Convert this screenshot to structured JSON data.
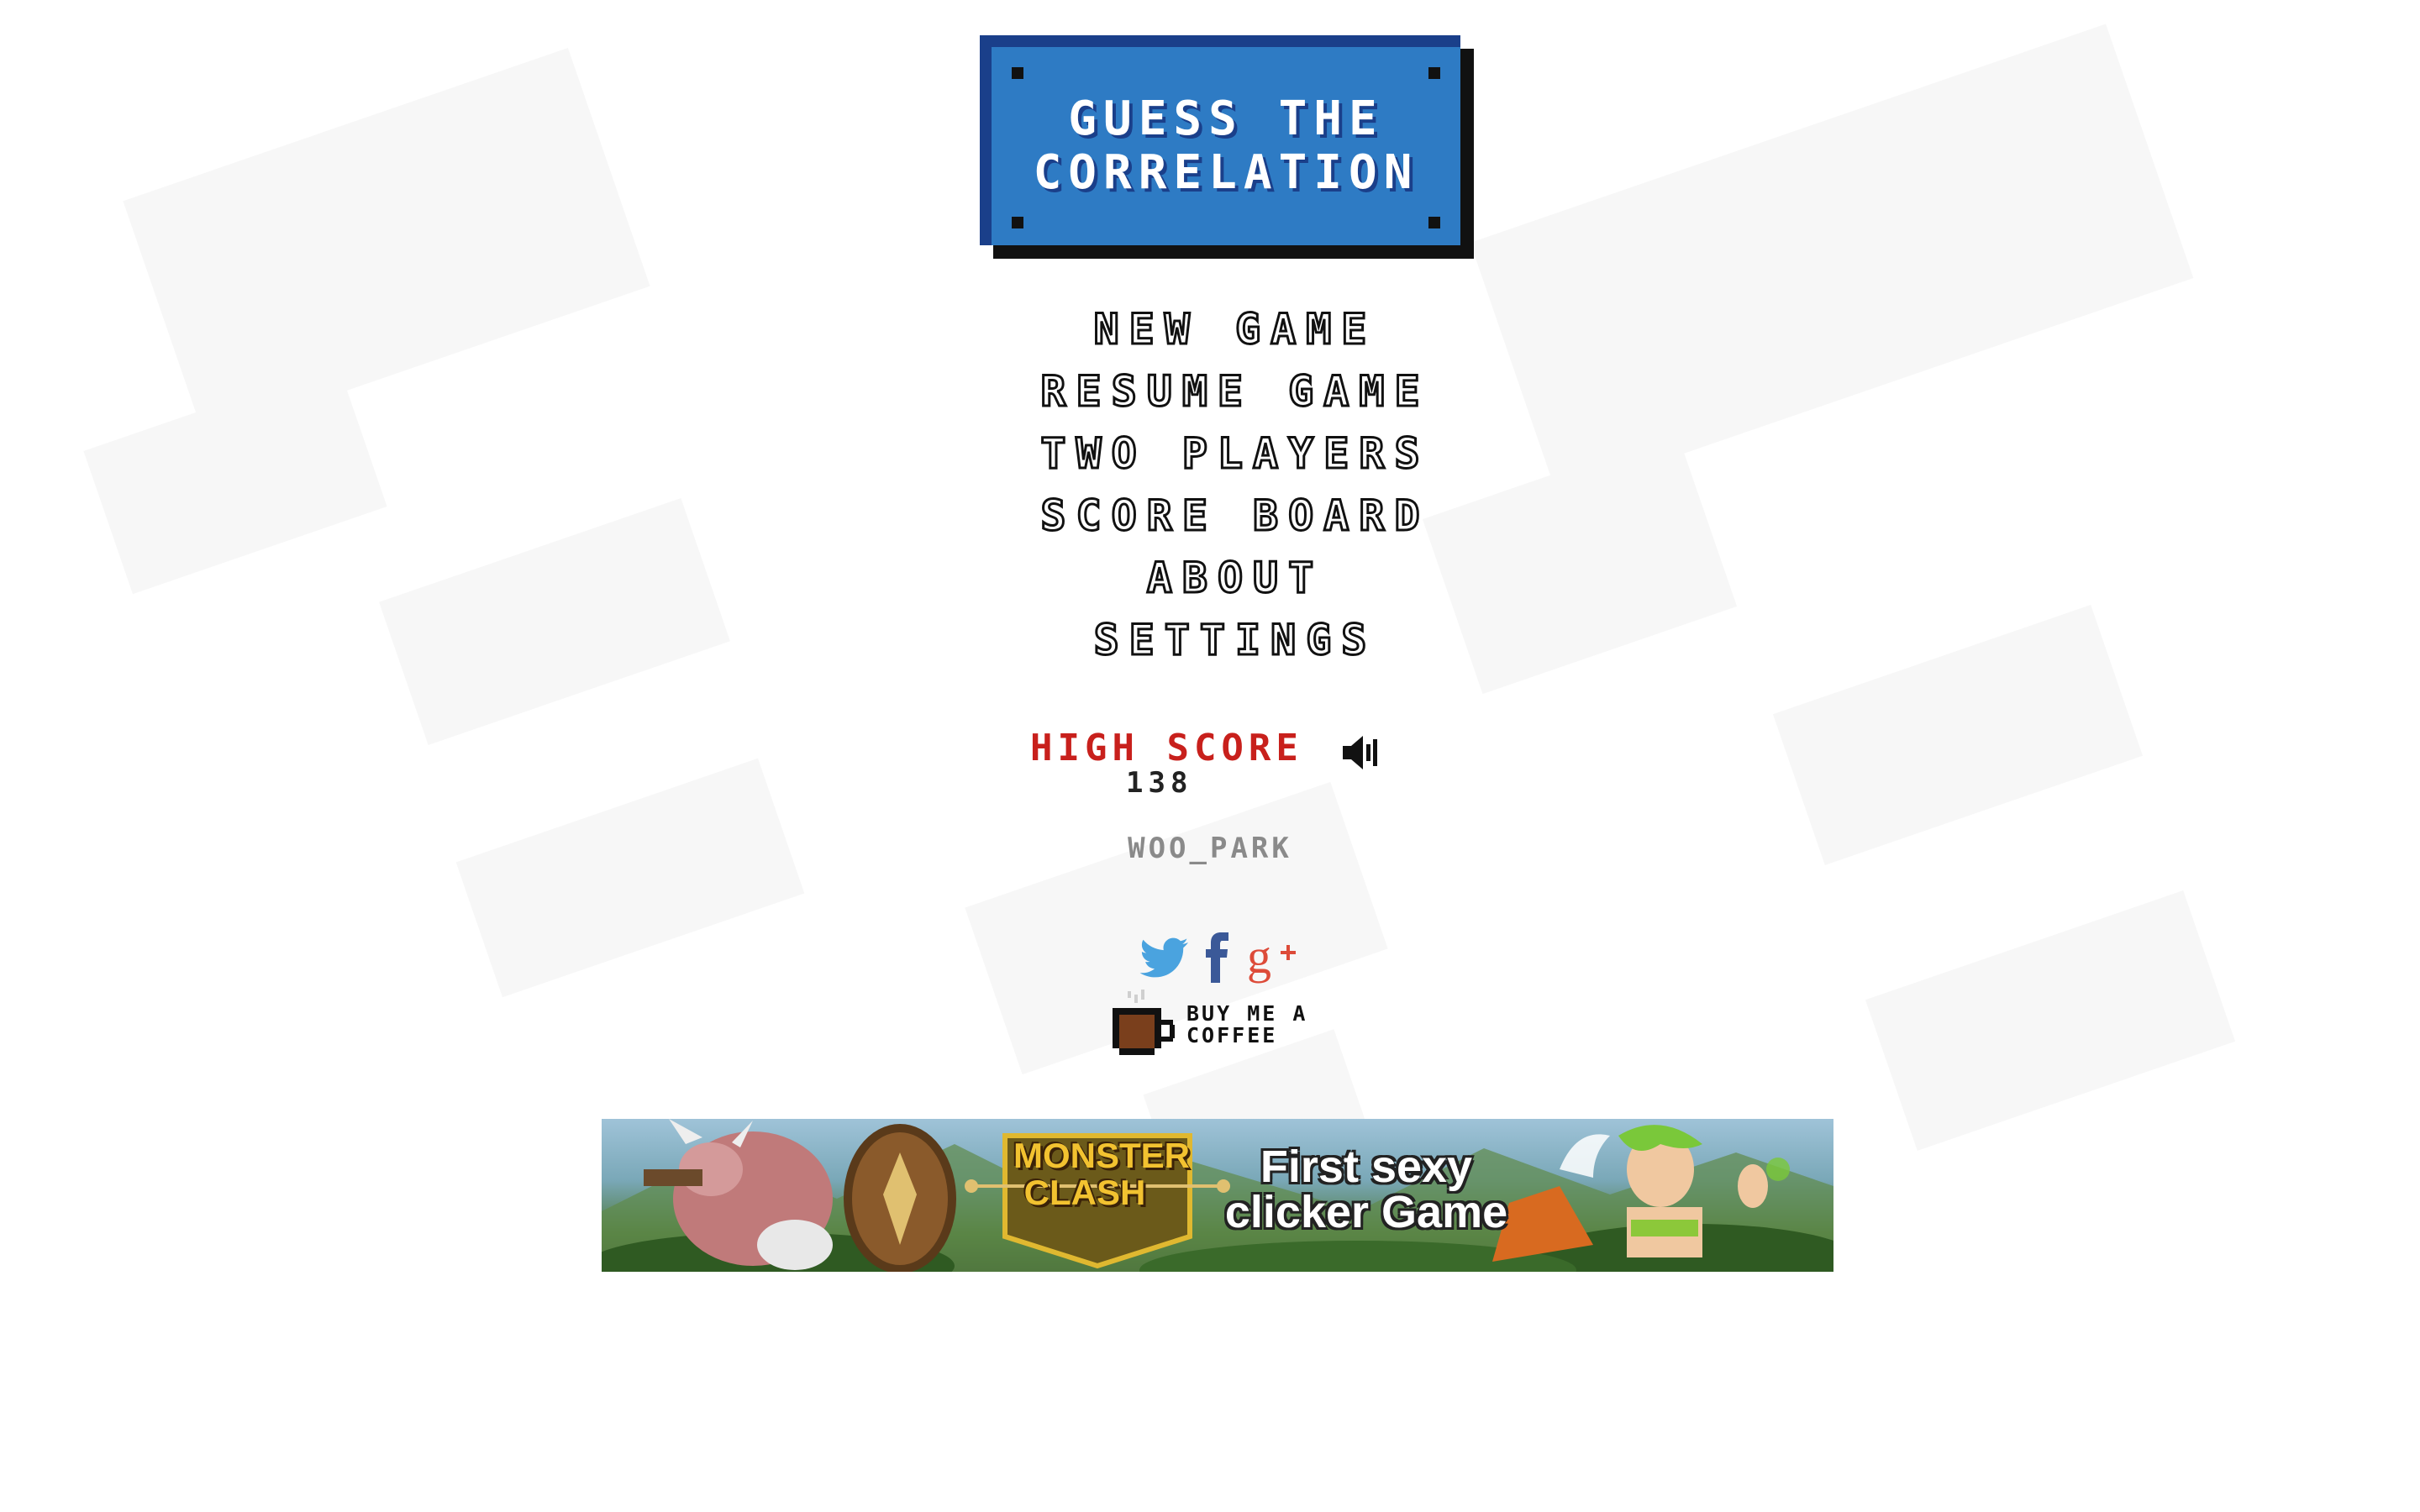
{
  "title": {
    "line1": "GUESS THE",
    "line2": "CORRELATION"
  },
  "menu": {
    "items": [
      {
        "label": "NEW GAME"
      },
      {
        "label": "RESUME GAME"
      },
      {
        "label": "TWO PLAYERS"
      },
      {
        "label": "SCORE BOARD"
      },
      {
        "label": "ABOUT"
      },
      {
        "label": "SETTINGS"
      }
    ]
  },
  "high_score": {
    "label": "HIGH SCORE",
    "value": "138"
  },
  "user": {
    "name": "WOO_PARK"
  },
  "social": {
    "icons": [
      "twitter-icon",
      "facebook-icon",
      "google-plus-icon"
    ],
    "coffee_line1": "BUY ME A",
    "coffee_line2": "COFFEE"
  },
  "ad": {
    "logo_line1": "MONSTER",
    "logo_line2": "CLASH",
    "headline_line1": "First sexy",
    "headline_line2": "clicker Game"
  },
  "colors": {
    "title_bg": "#2e7bc4",
    "title_border": "#1a3f8a",
    "high_score_red": "#c8201c",
    "username_gray": "#8a8a8a",
    "twitter_blue": "#4aa3df",
    "facebook_blue": "#3b5998",
    "google_red": "#dd4b39",
    "coffee_brown": "#7a3f1c"
  }
}
